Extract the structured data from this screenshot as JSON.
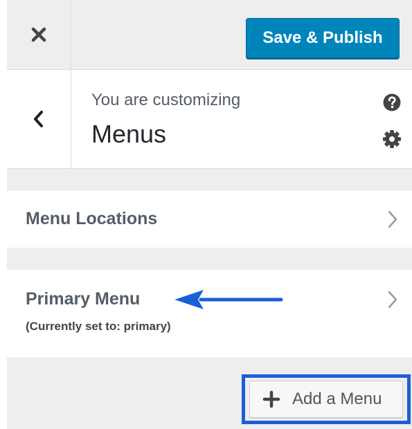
{
  "header": {
    "close_icon": "close-icon",
    "save_label": "Save & Publish"
  },
  "info": {
    "back_icon": "chevron-left-icon",
    "pre_title": "You are customizing",
    "title": "Menus",
    "help_icon": "help-icon",
    "settings_icon": "gear-icon"
  },
  "sections": {
    "locations": {
      "title": "Menu Locations",
      "icon": "chevron-right-icon"
    },
    "primary": {
      "title": "Primary Menu",
      "subtitle": "(Currently set to: primary)",
      "icon": "chevron-right-icon"
    }
  },
  "add_menu": {
    "label": "Add a Menu",
    "icon": "plus-icon"
  },
  "colors": {
    "accent": "#0085ba",
    "panel_bg": "#eeeeee",
    "annotation": "#1a5fd6"
  }
}
